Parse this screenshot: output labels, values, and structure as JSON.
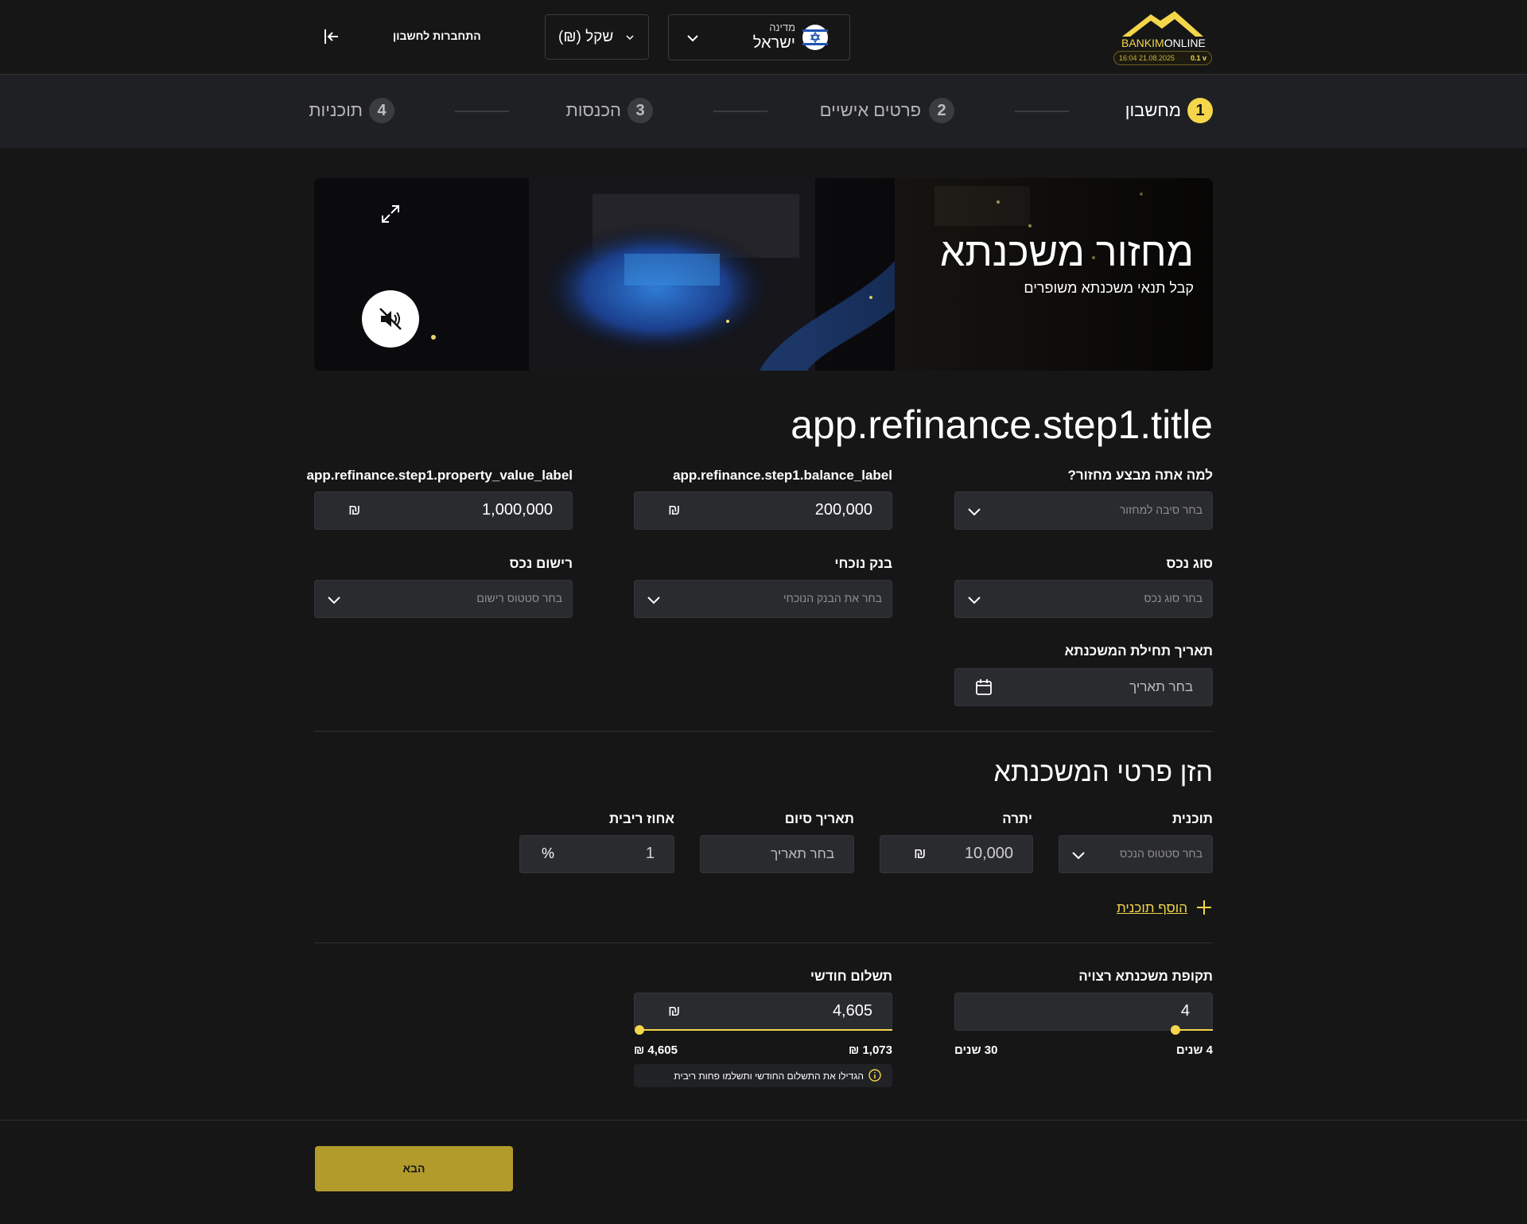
{
  "header": {
    "logo_text_a": "BANKIM",
    "logo_text_b": "ONLINE",
    "logo_meta": "16:04 21.08.2025",
    "logo_version": "0.1 v",
    "country_label": "מדינה",
    "country_value": "ישראל",
    "currency_value": "(₪) שקל",
    "login_label": "התחברות לחשבון"
  },
  "steps": [
    {
      "num": "1",
      "label": "מחשבון"
    },
    {
      "num": "2",
      "label": "פרטים אישיים"
    },
    {
      "num": "3",
      "label": "הכנסות"
    },
    {
      "num": "4",
      "label": "תוכניות"
    }
  ],
  "banner": {
    "title": "מחזור משכנתא",
    "subtitle": "קבל תנאי משכנתא משופרים"
  },
  "form": {
    "title": "app.refinance.step1.title",
    "why_label": "למה אתה מבצע מחזור?",
    "why_placeholder": "בחר סיבה למחזור",
    "balance_label": "app.refinance.step1.balance_label",
    "balance_value": "200,000",
    "property_value_label": "app.refinance.step1.property_value_label",
    "property_value": "1,000,000",
    "currency_symbol": "₪",
    "property_type_label": "סוג נכס",
    "property_type_placeholder": "בחר סוג נכס",
    "current_bank_label": "בנק נוכחי",
    "current_bank_placeholder": "בחר את הבנק הנוכחי",
    "registration_label": "רישום נכס",
    "registration_placeholder": "בחר סטטוס רישום",
    "start_date_label": "תאריך תחילת המשכנתא",
    "start_date_placeholder": "בחר תאריך"
  },
  "mortgage": {
    "title": "הזן פרטי המשכנתא",
    "program_label": "תוכנית",
    "program_placeholder": "בחר סטטוס הנכס",
    "balance_label": "יתרה",
    "balance_value": "10,000",
    "end_date_label": "תאריך סיום",
    "end_date_placeholder": "בחר תאריך",
    "rate_label": "אחוז ריבית",
    "rate_value": "1",
    "rate_symbol": "%",
    "add_program": "הוסף תוכנית"
  },
  "terms": {
    "period_label": "תקופת משכנתא רצויה",
    "period_value": "4",
    "period_min": "4 שנים",
    "period_max": "30 שנים",
    "payment_label": "תשלום חודשי",
    "payment_value": "4,605",
    "payment_min": "₪ 1,073",
    "payment_max": "₪ 4,605",
    "hint": "הגדילו את התשלום החודשי ותשלמו פחות ריבית"
  },
  "footer": {
    "next_label": "הבא"
  },
  "colors": {
    "accent": "#f3d64a",
    "button": "#b39b2b",
    "field": "#2a2b2f"
  }
}
